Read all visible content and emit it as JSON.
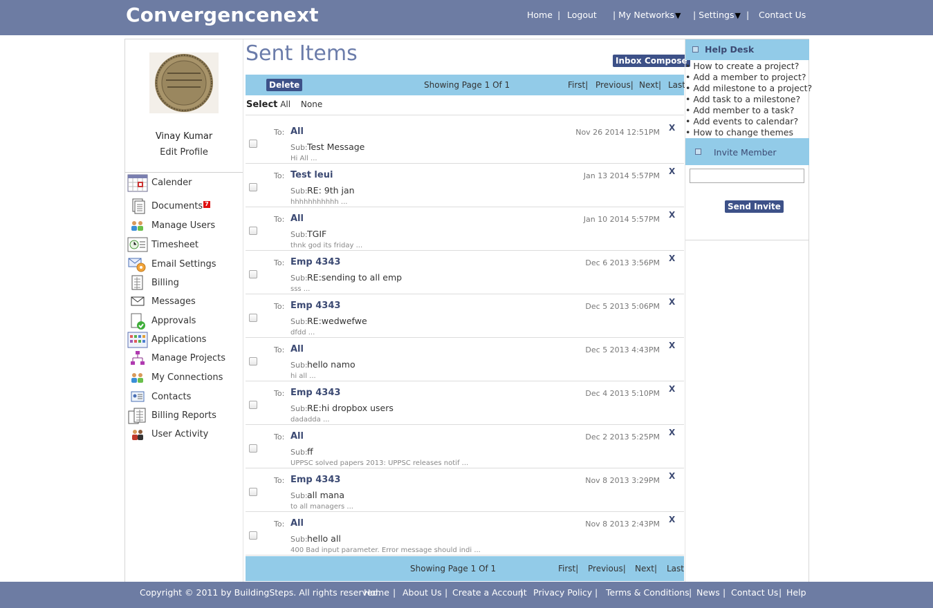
{
  "header": {
    "logo": "Convergencenext",
    "nav": {
      "home": "Home",
      "sep1": "|",
      "logout": "Logout",
      "my_networks": "| My Networks",
      "settings": "| Settings",
      "sep4": "|",
      "contact": "Contact Us",
      "dropdown_glyph": "▼"
    }
  },
  "profile": {
    "name": "Vinay Kumar",
    "edit": "Edit Profile"
  },
  "sidebar": {
    "items": [
      {
        "label": "Calender",
        "icon": "calendar-icon"
      },
      {
        "label": "Documents",
        "badge": "7",
        "icon": "documents-icon"
      },
      {
        "label": "Manage Users",
        "icon": "users-icon"
      },
      {
        "label": "Timesheet",
        "icon": "timesheet-icon"
      },
      {
        "label": "Email Settings",
        "icon": "email-settings-icon"
      },
      {
        "label": "Billing",
        "icon": "billing-icon"
      },
      {
        "label": "Messages",
        "icon": "messages-icon"
      },
      {
        "label": "Approvals",
        "icon": "approvals-icon"
      },
      {
        "label": "Applications",
        "icon": "applications-icon"
      },
      {
        "label": "Manage Projects",
        "icon": "projects-icon"
      },
      {
        "label": "My Connections",
        "icon": "connections-icon"
      },
      {
        "label": "Contacts",
        "icon": "contacts-icon"
      },
      {
        "label": "Billing Reports",
        "icon": "billing-reports-icon"
      },
      {
        "label": "User Activity",
        "icon": "user-activity-icon"
      }
    ]
  },
  "main": {
    "title": "Sent Items",
    "inbox_button": "Inbox",
    "compose_button": "Compose",
    "delete_button": "Delete",
    "showing": "Showing Page 1 Of 1",
    "first": "First|",
    "previous": "Previous|",
    "next": "Next|",
    "last": "Last",
    "select_label": "Select",
    "select_all": "All",
    "select_none": "None",
    "to_label": "To:",
    "sub_label": "Sub:",
    "delete_glyph": "X",
    "messages": [
      {
        "to": "All",
        "date": "Nov 26 2014 12:51PM",
        "subject": "Test Message",
        "preview": "Hi All ..."
      },
      {
        "to": "Test leui",
        "date": "Jan 13 2014 5:57PM",
        "subject": "RE: 9th jan",
        "preview": "hhhhhhhhhhh ..."
      },
      {
        "to": "All",
        "date": "Jan 10 2014 5:57PM",
        "subject": "TGIF",
        "preview": "thnk god its friday ..."
      },
      {
        "to": "Emp 4343",
        "date": "Dec 6 2013 3:56PM",
        "subject": "RE:sending to all emp",
        "preview": "sss ..."
      },
      {
        "to": "Emp 4343",
        "date": "Dec 5 2013 5:06PM",
        "subject": "RE:wedwefwe",
        "preview": "dfdd ..."
      },
      {
        "to": "All",
        "date": "Dec 5 2013 4:43PM",
        "subject": "hello namo",
        "preview": "hi all ..."
      },
      {
        "to": "Emp 4343",
        "date": "Dec 4 2013 5:10PM",
        "subject": "RE:hi dropbox users",
        "preview": "dadadda ..."
      },
      {
        "to": "All",
        "date": "Dec 2 2013 5:25PM",
        "subject": "ff",
        "preview": "UPPSC solved papers 2013: UPPSC releases notif ..."
      },
      {
        "to": "Emp 4343",
        "date": "Nov 8 2013 3:29PM",
        "subject": "all mana",
        "preview": "to all managers ..."
      },
      {
        "to": "All",
        "date": "Nov 8 2013 2:43PM",
        "subject": "hello all",
        "preview": "400 Bad input parameter. Error message should indi ..."
      }
    ]
  },
  "helpdesk": {
    "title": "Help Desk",
    "bullet": "•",
    "items": [
      "How to create a project?",
      "Add a member to project?",
      "Add milestone to a project?",
      "Add task to a milestone?",
      "Add member to a task?",
      "Add events to calendar?",
      "How to change themes"
    ]
  },
  "invite": {
    "title": "Invite Member",
    "button": "Send Invite"
  },
  "footer": {
    "copyright": "Copyright © 2011 by BuildingSteps. All rights reserved.",
    "links": [
      "Home",
      "About Us",
      "Create a Account",
      "Privacy Policy",
      "Terms & Conditions",
      "News",
      "Contact Us",
      "Help"
    ],
    "sep": "|"
  },
  "colors": {
    "header_bg": "#6d7ca3",
    "bar_bg": "#92cbe8",
    "button_bg": "#3d5188",
    "title": "#6b7caa",
    "badge": "#e01010"
  }
}
